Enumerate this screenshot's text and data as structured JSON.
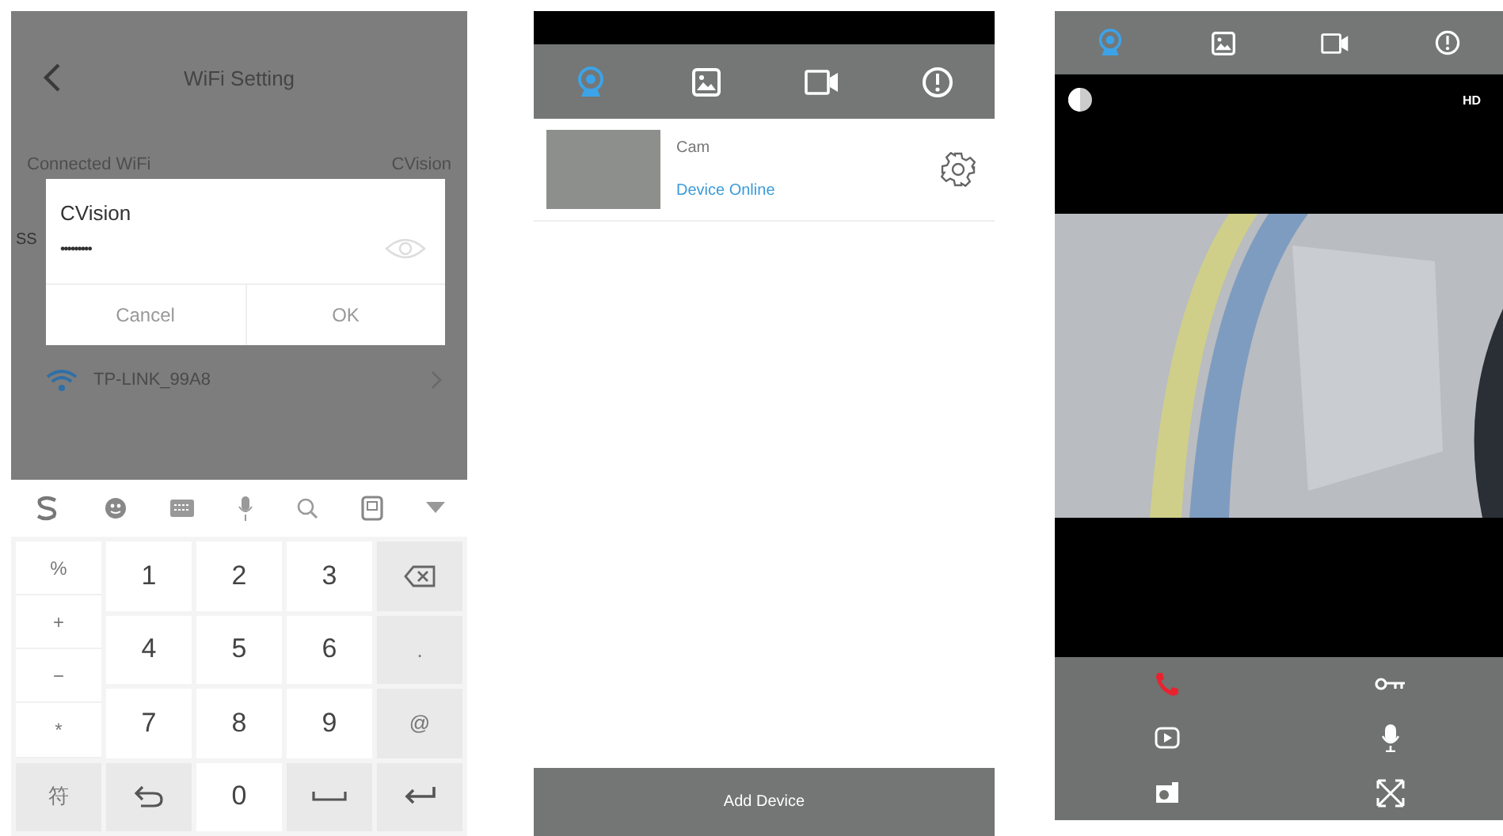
{
  "wifi_screen": {
    "title": "WiFi Setting",
    "connected_label": "Connected WiFi",
    "connected_value": "CVision",
    "section_label": "SS",
    "dialog": {
      "title": "CVision",
      "password": "•••••••••",
      "buttons": [
        "Cancel",
        "OK"
      ]
    },
    "networks": [
      {
        "name": "TP-LINK_99A8"
      }
    ]
  },
  "keyboard": {
    "symbols": [
      "%",
      "+",
      "−",
      "*"
    ],
    "digits": [
      "1",
      "2",
      "3",
      "4",
      "5",
      "6",
      "7",
      "8",
      "9"
    ],
    "side_keys": [
      {
        "kind": "backspace"
      },
      {
        "kind": "text",
        "label": "."
      },
      {
        "kind": "text",
        "label": "@"
      }
    ],
    "bottom_keys": [
      {
        "kind": "text",
        "label": "符"
      },
      {
        "kind": "undo"
      },
      {
        "kind": "text",
        "label": "0"
      },
      {
        "kind": "space"
      },
      {
        "kind": "enter"
      }
    ]
  },
  "device_screen": {
    "tabs": [
      {
        "kind": "camera",
        "selected": true
      },
      {
        "kind": "picture",
        "selected": false
      },
      {
        "kind": "video",
        "selected": false
      },
      {
        "kind": "alert",
        "selected": false
      }
    ],
    "devices": [
      {
        "name": "Cam",
        "status": "Device Online"
      }
    ],
    "add_button": "Add Device"
  },
  "live_screen": {
    "tabs": [
      {
        "kind": "camera",
        "selected": true
      },
      {
        "kind": "picture",
        "selected": false
      },
      {
        "kind": "video",
        "selected": false
      },
      {
        "kind": "alert",
        "selected": false
      }
    ],
    "quality": "HD"
  }
}
